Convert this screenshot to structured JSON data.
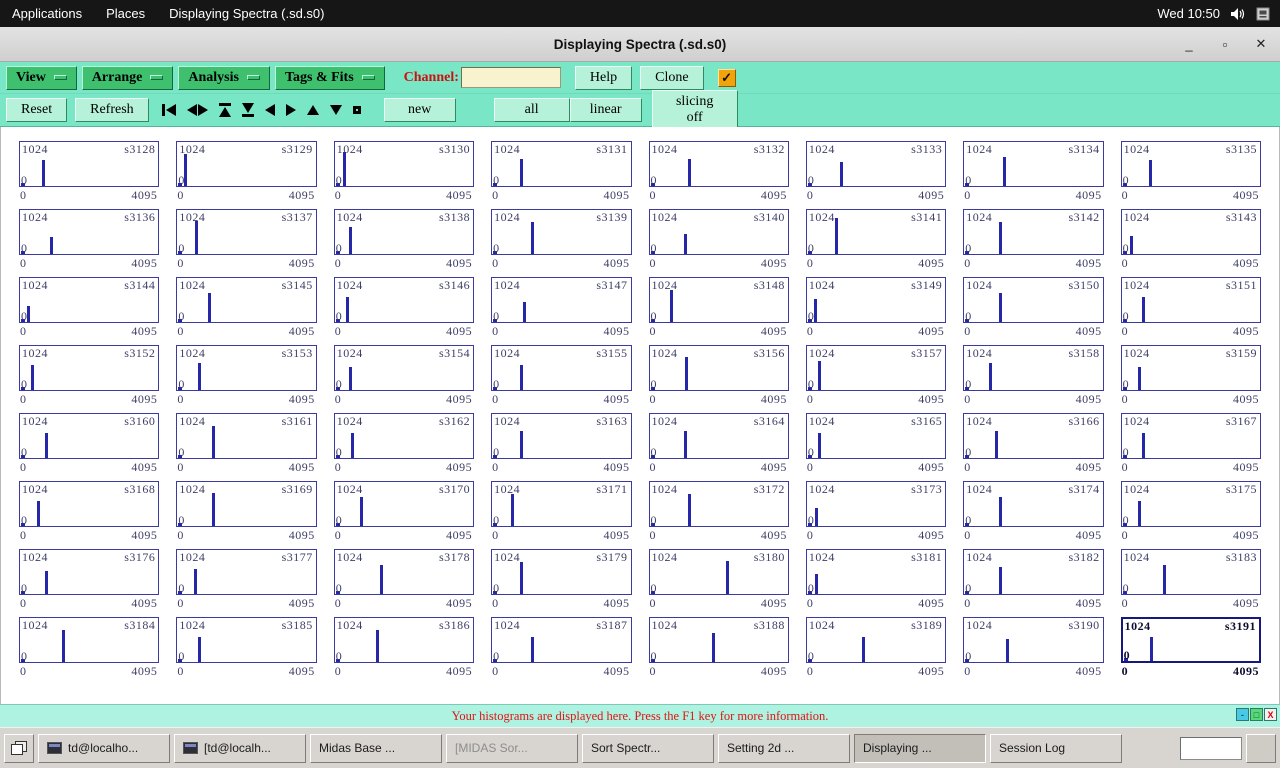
{
  "desktop_bar": {
    "applications": "Applications",
    "places": "Places",
    "active_window": "Displaying Spectra (.sd.s0)",
    "clock": "Wed 10:50"
  },
  "window": {
    "title": "Displaying Spectra (.sd.s0)",
    "minimize_glyph": "_",
    "maximize_glyph": "▫",
    "close_glyph": "✕"
  },
  "toolbar": {
    "menus": [
      {
        "label": "View"
      },
      {
        "label": "Arrange"
      },
      {
        "label": "Analysis"
      },
      {
        "label": "Tags & Fits"
      }
    ],
    "channel_label": "Channel:",
    "channel_value": "",
    "help_label": "Help",
    "clone_label": "Clone",
    "checkbox_checked": true,
    "checkbox_glyph": "✓",
    "reset_label": "Reset",
    "refresh_label": "Refresh",
    "nav_icons": [
      "first-icon",
      "expand-icon",
      "to-top-icon",
      "to-bottom-icon",
      "left-icon",
      "right-icon",
      "up-icon",
      "down-icon",
      "stop-icon"
    ],
    "new_label": "new",
    "all_label": "all",
    "linear_label": "linear",
    "slicing_label": "slicing off"
  },
  "status_bar": {
    "message": "Your histograms are displayed here. Press the F1 key for more information.",
    "minimize_glyph": "-",
    "maximize_glyph": "□",
    "close_glyph": "X"
  },
  "taskbar": {
    "items": [
      {
        "label": "td@localho...",
        "icon": "terminal",
        "state": "normal"
      },
      {
        "label": "[td@localh...",
        "icon": "terminal",
        "state": "normal"
      },
      {
        "label": "Midas Base ...",
        "icon": "",
        "state": "normal"
      },
      {
        "label": "[MIDAS Sor...",
        "icon": "",
        "state": "disabled"
      },
      {
        "label": "Sort Spectr...",
        "icon": "",
        "state": "normal"
      },
      {
        "label": "Setting 2d ...",
        "icon": "",
        "state": "normal"
      },
      {
        "label": "Displaying ...",
        "icon": "",
        "state": "active"
      },
      {
        "label": "Session Log",
        "icon": "",
        "state": "normal"
      }
    ]
  },
  "spectra": {
    "ymax": "1024",
    "ymin": "0",
    "xmin": "0",
    "xmax": "4095",
    "panels": [
      {
        "name": "s3128",
        "x": 0.16,
        "h": 0.58
      },
      {
        "name": "s3129",
        "x": 0.05,
        "h": 0.72
      },
      {
        "name": "s3130",
        "x": 0.06,
        "h": 0.78
      },
      {
        "name": "s3131",
        "x": 0.2,
        "h": 0.62
      },
      {
        "name": "s3132",
        "x": 0.28,
        "h": 0.62
      },
      {
        "name": "s3133",
        "x": 0.24,
        "h": 0.55
      },
      {
        "name": "s3134",
        "x": 0.28,
        "h": 0.66
      },
      {
        "name": "s3135",
        "x": 0.2,
        "h": 0.6
      },
      {
        "name": "s3136",
        "x": 0.22,
        "h": 0.38
      },
      {
        "name": "s3137",
        "x": 0.13,
        "h": 0.76
      },
      {
        "name": "s3138",
        "x": 0.1,
        "h": 0.62
      },
      {
        "name": "s3139",
        "x": 0.28,
        "h": 0.72
      },
      {
        "name": "s3140",
        "x": 0.25,
        "h": 0.46
      },
      {
        "name": "s3141",
        "x": 0.2,
        "h": 0.82
      },
      {
        "name": "s3142",
        "x": 0.25,
        "h": 0.72
      },
      {
        "name": "s3143",
        "x": 0.06,
        "h": 0.42
      },
      {
        "name": "s3144",
        "x": 0.05,
        "h": 0.36
      },
      {
        "name": "s3145",
        "x": 0.22,
        "h": 0.66
      },
      {
        "name": "s3146",
        "x": 0.08,
        "h": 0.56
      },
      {
        "name": "s3147",
        "x": 0.22,
        "h": 0.46
      },
      {
        "name": "s3148",
        "x": 0.15,
        "h": 0.72
      },
      {
        "name": "s3149",
        "x": 0.05,
        "h": 0.52
      },
      {
        "name": "s3150",
        "x": 0.25,
        "h": 0.66
      },
      {
        "name": "s3151",
        "x": 0.15,
        "h": 0.56
      },
      {
        "name": "s3152",
        "x": 0.08,
        "h": 0.56
      },
      {
        "name": "s3153",
        "x": 0.15,
        "h": 0.62
      },
      {
        "name": "s3154",
        "x": 0.1,
        "h": 0.52
      },
      {
        "name": "s3155",
        "x": 0.2,
        "h": 0.56
      },
      {
        "name": "s3156",
        "x": 0.26,
        "h": 0.76
      },
      {
        "name": "s3157",
        "x": 0.08,
        "h": 0.66
      },
      {
        "name": "s3158",
        "x": 0.18,
        "h": 0.62
      },
      {
        "name": "s3159",
        "x": 0.12,
        "h": 0.52
      },
      {
        "name": "s3160",
        "x": 0.18,
        "h": 0.56
      },
      {
        "name": "s3161",
        "x": 0.25,
        "h": 0.72
      },
      {
        "name": "s3162",
        "x": 0.12,
        "h": 0.56
      },
      {
        "name": "s3163",
        "x": 0.2,
        "h": 0.62
      },
      {
        "name": "s3164",
        "x": 0.25,
        "h": 0.62
      },
      {
        "name": "s3165",
        "x": 0.08,
        "h": 0.56
      },
      {
        "name": "s3166",
        "x": 0.22,
        "h": 0.62
      },
      {
        "name": "s3167",
        "x": 0.15,
        "h": 0.56
      },
      {
        "name": "s3168",
        "x": 0.12,
        "h": 0.56
      },
      {
        "name": "s3169",
        "x": 0.25,
        "h": 0.76
      },
      {
        "name": "s3170",
        "x": 0.18,
        "h": 0.66
      },
      {
        "name": "s3171",
        "x": 0.14,
        "h": 0.72
      },
      {
        "name": "s3172",
        "x": 0.28,
        "h": 0.72
      },
      {
        "name": "s3173",
        "x": 0.06,
        "h": 0.42
      },
      {
        "name": "s3174",
        "x": 0.25,
        "h": 0.66
      },
      {
        "name": "s3175",
        "x": 0.12,
        "h": 0.56
      },
      {
        "name": "s3176",
        "x": 0.18,
        "h": 0.52
      },
      {
        "name": "s3177",
        "x": 0.12,
        "h": 0.56
      },
      {
        "name": "s3178",
        "x": 0.33,
        "h": 0.66
      },
      {
        "name": "s3179",
        "x": 0.2,
        "h": 0.72
      },
      {
        "name": "s3180",
        "x": 0.55,
        "h": 0.76
      },
      {
        "name": "s3181",
        "x": 0.06,
        "h": 0.46
      },
      {
        "name": "s3182",
        "x": 0.25,
        "h": 0.62
      },
      {
        "name": "s3183",
        "x": 0.3,
        "h": 0.66
      },
      {
        "name": "s3184",
        "x": 0.3,
        "h": 0.72
      },
      {
        "name": "s3185",
        "x": 0.15,
        "h": 0.56
      },
      {
        "name": "s3186",
        "x": 0.3,
        "h": 0.72
      },
      {
        "name": "s3187",
        "x": 0.28,
        "h": 0.56
      },
      {
        "name": "s3188",
        "x": 0.45,
        "h": 0.66
      },
      {
        "name": "s3189",
        "x": 0.4,
        "h": 0.56
      },
      {
        "name": "s3190",
        "x": 0.3,
        "h": 0.52
      },
      {
        "name": "s3191",
        "x": 0.2,
        "h": 0.56,
        "selected": true
      }
    ]
  }
}
